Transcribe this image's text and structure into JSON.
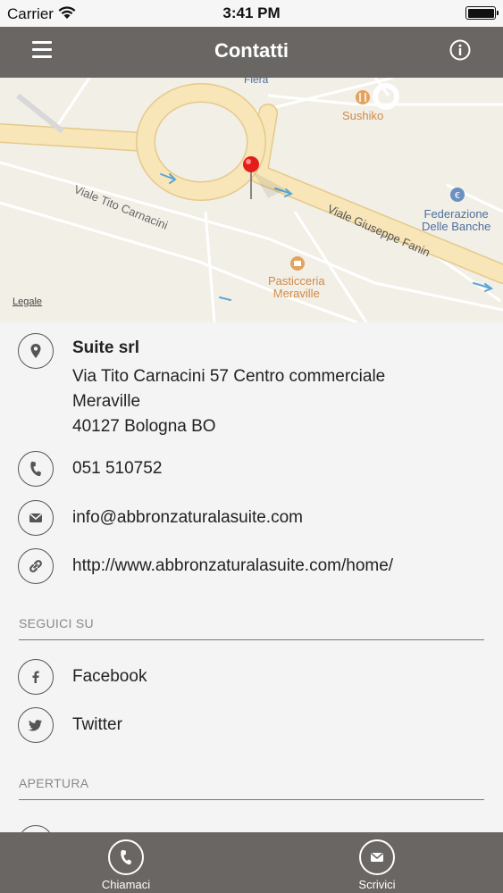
{
  "status_bar": {
    "carrier": "Carrier",
    "time": "3:41 PM"
  },
  "nav": {
    "title": "Contatti"
  },
  "map": {
    "labels": {
      "fiera": "Fiera",
      "sushiko": "Sushiko",
      "viale_tito": "Viale Tito Carnacini",
      "viale_giuseppe": "Viale Giuseppe Fanin",
      "federazione_1": "Federazione",
      "federazione_2": "Delle Banche",
      "pasticceria_1": "Pasticceria",
      "pasticceria_2": "Meraville"
    },
    "legal": "Legale"
  },
  "contact": {
    "name": "Suite srl",
    "address_line1": "Via Tito Carnacini 57 Centro commerciale",
    "address_line2": "Meraville",
    "address_line3": "40127 Bologna BO",
    "phone": "051 510752",
    "email": "info@abbronzaturalasuite.com",
    "website": "http://www.abbronzaturalasuite.com/home/"
  },
  "social": {
    "section_title": "SEGUICI SU",
    "items": [
      {
        "label": "Facebook",
        "icon": "facebook-icon"
      },
      {
        "label": "Twitter",
        "icon": "twitter-icon"
      }
    ]
  },
  "opening": {
    "section_title": "APERTURA"
  },
  "bottom_bar": {
    "call_label": "Chiamaci",
    "write_label": "Scrivici"
  },
  "colors": {
    "nav_bg": "#6a6664",
    "content_bg": "#f4f4f4",
    "road": "#f8e6b8",
    "road_edge": "#e4c98a",
    "pin": "#e31c1c"
  }
}
